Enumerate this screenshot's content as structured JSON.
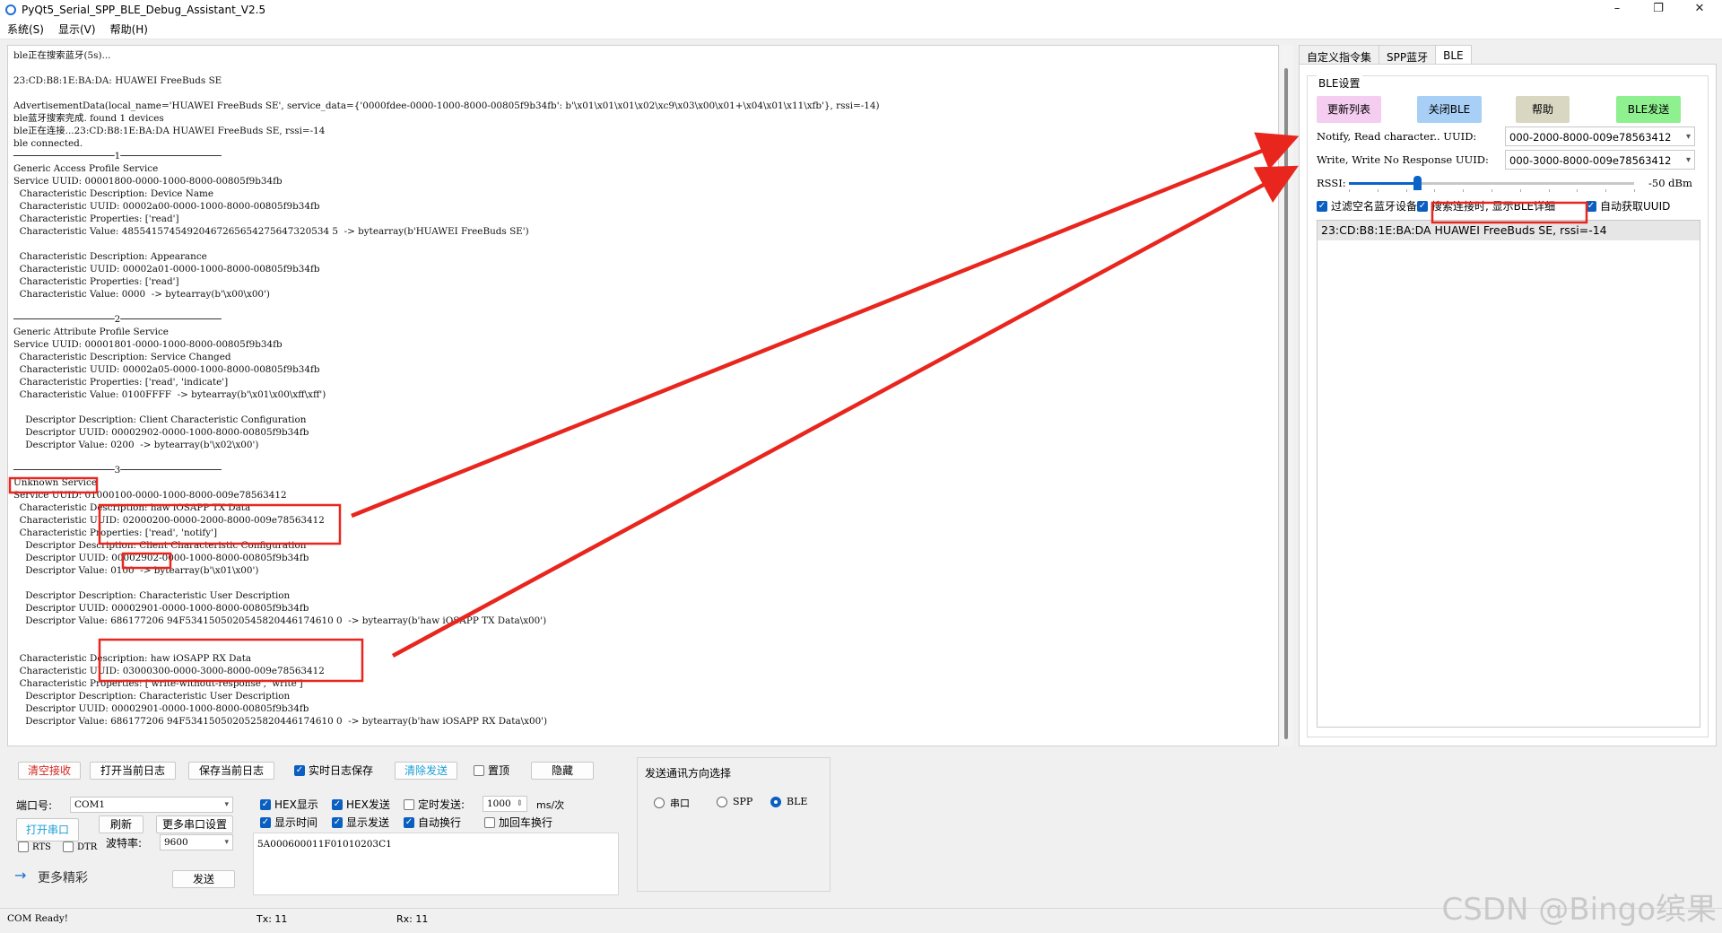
{
  "window": {
    "title": "PyQt5_Serial_SPP_BLE_Debug_Assistant_V2.5",
    "controls": [
      "–",
      "❐",
      "✕"
    ]
  },
  "menu": [
    "系统(S)",
    "显示(V)",
    "帮助(H)"
  ],
  "log_lines": [
    "ble正在搜索蓝牙(5s)...",
    "",
    "23:CD:B8:1E:BA:DA: HUAWEI FreeBuds SE",
    "",
    "AdvertisementData(local_name='HUAWEI FreeBuds SE', service_data={'0000fdee-0000-1000-8000-00805f9b34fb': b'\\x01\\x01\\x01\\x02\\xc9\\x03\\x00\\x01+\\x04\\x01\\x11\\xfb'}, rssi=-14)",
    "ble蓝牙搜索完成. found 1 devices",
    "ble正在连接...23:CD:B8:1E:BA:DA HUAWEI FreeBuds SE, rssi=-14",
    "ble connected.",
    "──────────────────1──────────────────",
    "Generic Access Profile Service",
    "Service UUID: 00001800-0000-1000-8000-00805f9b34fb",
    "  Characteristic Description: Device Name",
    "  Characteristic UUID: 00002a00-0000-1000-8000-00805f9b34fb",
    "  Characteristic Properties: ['read']",
    "  Characteristic Value: 48554157454920467265654275647320534 5  -> bytearray(b'HUAWEI FreeBuds SE')",
    "",
    "  Characteristic Description: Appearance",
    "  Characteristic UUID: 00002a01-0000-1000-8000-00805f9b34fb",
    "  Characteristic Properties: ['read']",
    "  Characteristic Value: 0000  -> bytearray(b'\\x00\\x00')",
    "",
    "──────────────────2──────────────────",
    "Generic Attribute Profile Service",
    "Service UUID: 00001801-0000-1000-8000-00805f9b34fb",
    "  Characteristic Description: Service Changed",
    "  Characteristic UUID: 00002a05-0000-1000-8000-00805f9b34fb",
    "  Characteristic Properties: ['read', 'indicate']",
    "  Characteristic Value: 0100FFFF  -> bytearray(b'\\x01\\x00\\xff\\xff')",
    "",
    "    Descriptor Description: Client Characteristic Configuration",
    "    Descriptor UUID: 00002902-0000-1000-8000-00805f9b34fb",
    "    Descriptor Value: 0200  -> bytearray(b'\\x02\\x00')",
    "",
    "──────────────────3──────────────────",
    "Unknown Service",
    "Service UUID: 01000100-0000-1000-8000-009e78563412",
    "  Characteristic Description: haw iOSAPP TX Data",
    "  Characteristic UUID: 02000200-0000-2000-8000-009e78563412",
    "  Characteristic Properties: ['read', 'notify']",
    "    Descriptor Description: Client Characteristic Configuration",
    "    Descriptor UUID: 00002902-0000-1000-8000-00805f9b34fb",
    "    Descriptor Value: 0100  -> bytearray(b'\\x01\\x00')",
    "",
    "    Descriptor Description: Characteristic User Description",
    "    Descriptor UUID: 00002901-0000-1000-8000-00805f9b34fb",
    "    Descriptor Value: 686177206 94F5341505020545820446174610 0  -> bytearray(b'haw iOSAPP TX Data\\x00')",
    "",
    "",
    "  Characteristic Description: haw iOSAPP RX Data",
    "  Characteristic UUID: 03000300-0000-3000-8000-009e78563412",
    "  Characteristic Properties: ['write-without-response', 'write']",
    "    Descriptor Description: Characteristic User Description",
    "    Descriptor UUID: 00002901-0000-1000-8000-00805f9b34fb",
    "    Descriptor Value: 686177206 94F5341505020525820446174610 0  -> bytearray(b'haw iOSAPP RX Data\\x00')",
    "",
    "────────────────────────────────────────"
  ],
  "right_panel": {
    "tabs": [
      "自定义指令集",
      "SPP蓝牙",
      "BLE"
    ],
    "active_tab": "BLE",
    "group_title": "BLE设置",
    "buttons": [
      {
        "label": "更新列表",
        "color": "#f4cdf0"
      },
      {
        "label": "关闭BLE",
        "color": "#a8cff5"
      },
      {
        "label": "帮助",
        "color": "#d9d7c2"
      },
      {
        "label": "BLE发送",
        "color": "#8ff08f"
      }
    ],
    "notify_label": "Notify, Read character.. UUID:",
    "notify_value": "000-2000-8000-009e78563412",
    "write_label": "Write, Write No Response UUID:",
    "write_value": "000-3000-8000-009e78563412",
    "rssi_label": "RSSI:",
    "rssi_value": "-50 dBm",
    "rssi_fraction": 0.24,
    "checks": [
      {
        "label": "过滤空名蓝牙设备",
        "checked": true
      },
      {
        "label": "搜索连接时, 显示BLE详细",
        "checked": true
      },
      {
        "label": "自动获取UUID",
        "checked": true
      }
    ],
    "devices": [
      "23:CD:B8:1E:BA:DA HUAWEI FreeBuds SE, rssi=-14"
    ]
  },
  "bottom": {
    "buttons": {
      "clear_recv": "清空接收",
      "open_log": "打开当前日志",
      "save_log": "保存当前日志",
      "clear_send": "清除发送",
      "hide": "隐藏",
      "open_port": "打开串口",
      "refresh": "刷新",
      "more_settings": "更多串口设置",
      "send": "发送"
    },
    "realtime_save": {
      "label": "实时日志保存",
      "checked": true
    },
    "pin_top": {
      "label": "置顶",
      "checked": false
    },
    "port_label": "端口号:",
    "port_value": "COM1",
    "baud_label": "波特率:",
    "baud_value": "9600",
    "rts": {
      "label": "RTS",
      "checked": false
    },
    "dtr": {
      "label": "DTR",
      "checked": false
    },
    "more_link": "更多精彩",
    "options": [
      {
        "label": "HEX显示",
        "checked": true
      },
      {
        "label": "HEX发送",
        "checked": true
      },
      {
        "label": "定时发送:",
        "checked": false
      },
      {
        "label": "显示时间",
        "checked": true
      },
      {
        "label": "显示发送",
        "checked": true
      },
      {
        "label": "自动换行",
        "checked": true
      },
      {
        "label": "加回车换行",
        "checked": false
      }
    ],
    "timer_value": "1000",
    "timer_unit": "ms/次",
    "send_text": "5A000600011F01010203C1",
    "direction_title": "发送通讯方向选择",
    "directions": [
      {
        "label": "串口",
        "checked": false
      },
      {
        "label": "SPP",
        "checked": false
      },
      {
        "label": "BLE",
        "checked": true
      }
    ]
  },
  "status": {
    "left": "COM Ready!",
    "tx": "Tx: 11",
    "rx": "Rx: 11"
  },
  "watermark": "CSDN @Bingo缤果",
  "colors": {
    "accent": "#0a5fc1",
    "annotation": "#e8261e",
    "red_text_button": "#d8261e",
    "cyan_text_button": "#1aa0d8"
  }
}
